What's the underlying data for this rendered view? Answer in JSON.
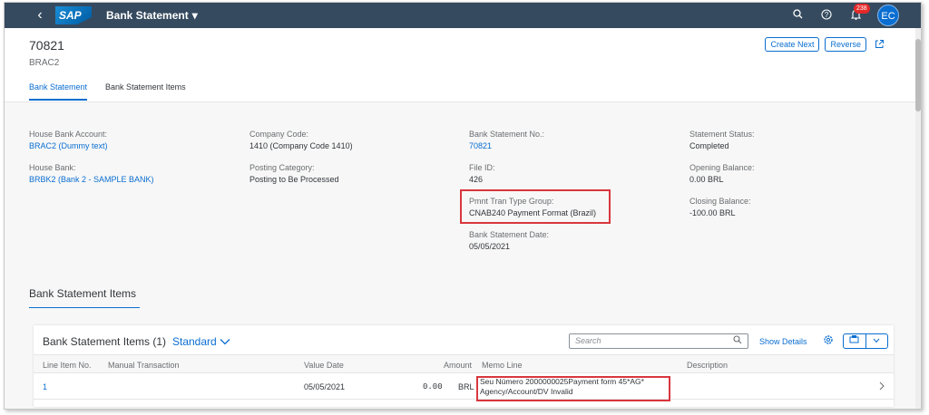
{
  "shell": {
    "back": "‹",
    "logo": "SAP",
    "app_title": "Bank Statement",
    "notification_count": "238",
    "avatar": "EC"
  },
  "header": {
    "title": "70821",
    "subtitle": "BRAC2",
    "create_next": "Create Next",
    "reverse": "Reverse",
    "tabs": [
      "Bank Statement",
      "Bank Statement Items"
    ]
  },
  "facets": {
    "house_bank_account_label": "House Bank Account:",
    "house_bank_account_value": "BRAC2 (Dummy text)",
    "house_bank_label": "House Bank:",
    "house_bank_value": "BRBK2 (Bank 2 - SAMPLE BANK)",
    "company_code_label": "Company Code:",
    "company_code_value": "1410 (Company Code 1410)",
    "posting_category_label": "Posting Category:",
    "posting_category_value": "Posting to Be Processed",
    "statement_no_label": "Bank Statement No.:",
    "statement_no_value": "70821",
    "file_id_label": "File ID:",
    "file_id_value": "426",
    "pmnt_label": "Pmnt Tran Type Group:",
    "pmnt_value": "CNAB240 Payment Format (Brazil)",
    "statement_date_label": "Bank Statement Date:",
    "statement_date_value": "05/05/2021",
    "status_label": "Statement Status:",
    "status_value": "Completed",
    "opening_label": "Opening Balance:",
    "opening_value": "0.00  BRL",
    "closing_label": "Closing Balance:",
    "closing_value": "-100.00  BRL"
  },
  "section": {
    "title": "Bank Statement Items"
  },
  "table": {
    "title": "Bank Statement Items (1)",
    "variant": "Standard",
    "search_placeholder": "Search",
    "show_details": "Show Details",
    "columns": [
      "Line Item No.",
      "Manual Transaction",
      "Value Date",
      "Amount",
      "Memo Line",
      "Description"
    ],
    "rows": [
      {
        "line_item": "1",
        "manual_transaction": "",
        "value_date": "05/05/2021",
        "amount": "0.00",
        "currency": "BRL",
        "memo_line1": "Seu Número 2000000025Payment form 45*AG*",
        "memo_line2": "Agency/Account/DV Invalid",
        "description": ""
      }
    ]
  },
  "colors": {
    "shell": "#354a5f",
    "accent": "#0a6ed1",
    "highlight": "#d9363e"
  }
}
